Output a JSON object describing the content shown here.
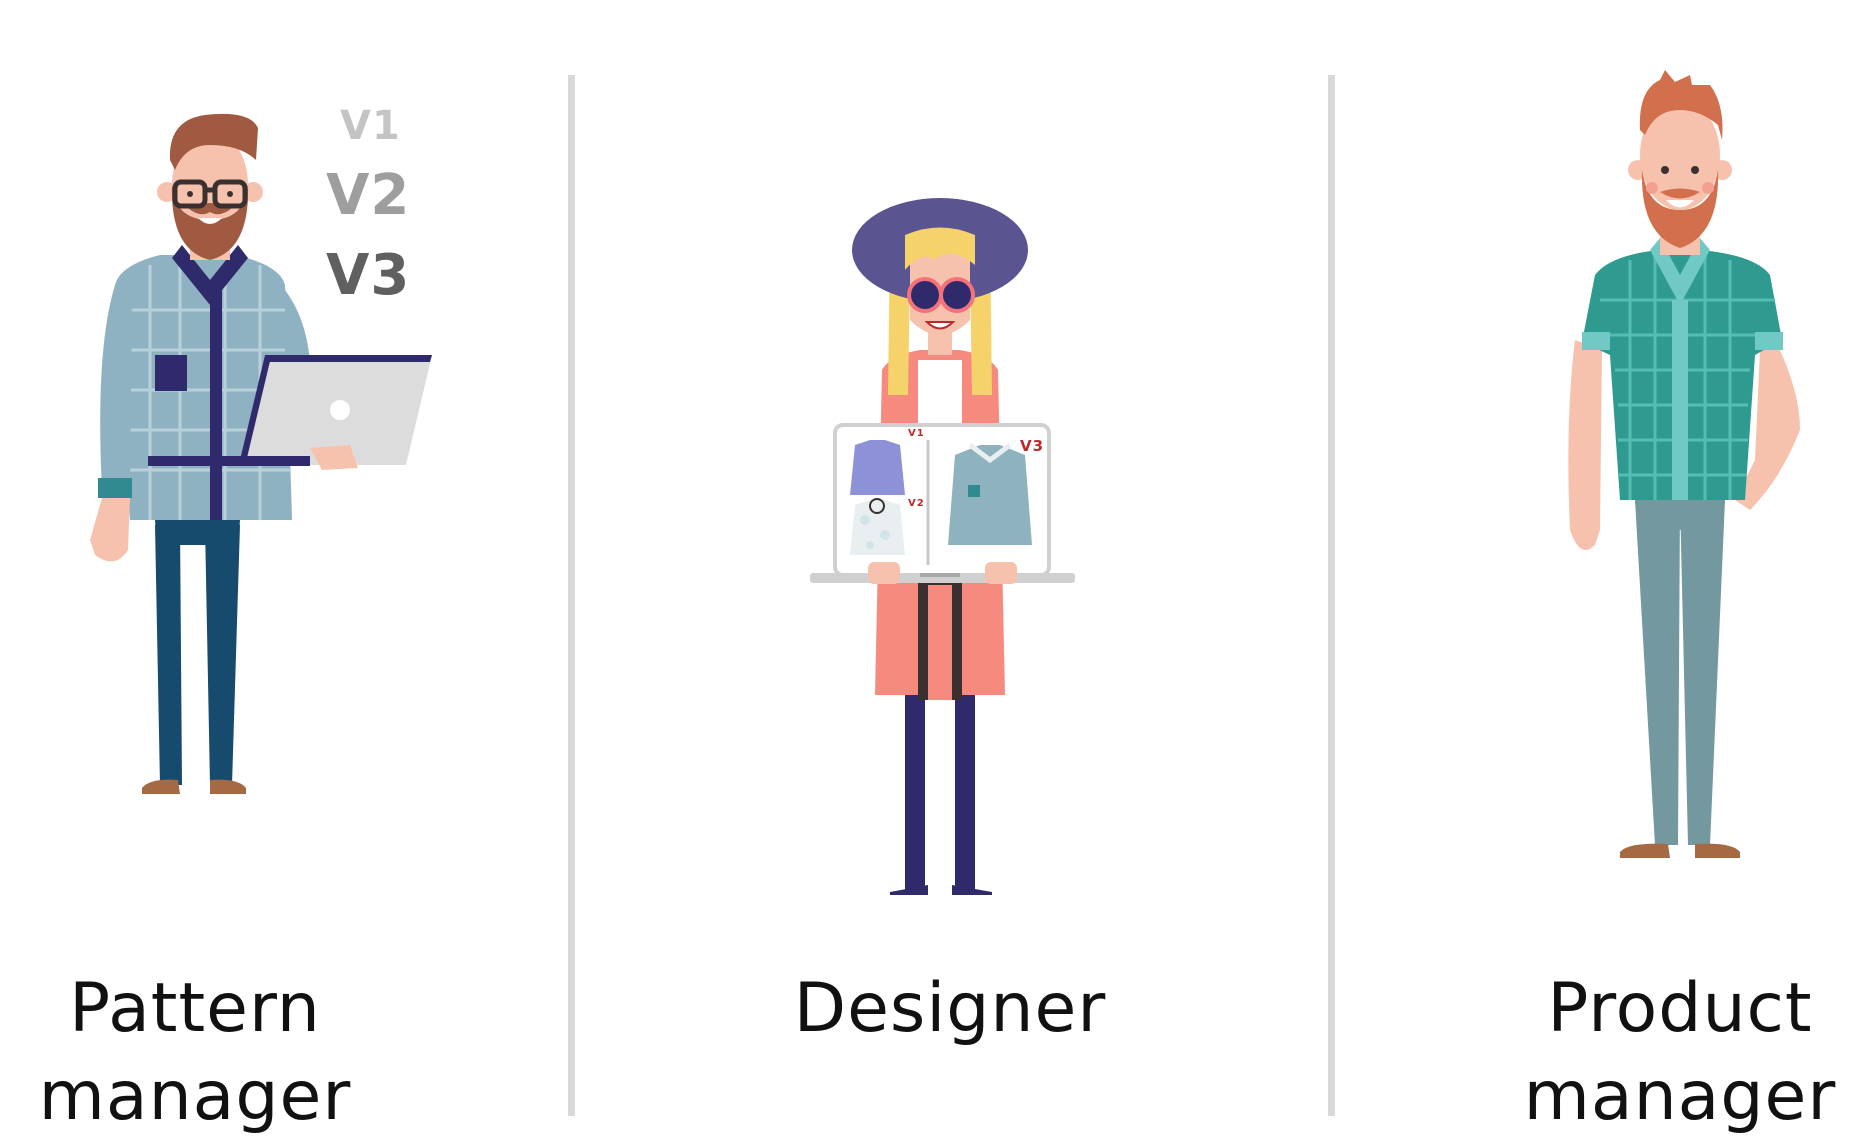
{
  "roles": [
    {
      "id": "pattern-manager",
      "line1": "Pattern",
      "line2": "manager"
    },
    {
      "id": "designer",
      "line1": "Designer"
    },
    {
      "id": "product-manager",
      "line1": "Product",
      "line2": "manager"
    }
  ],
  "versions": {
    "v1": "V1",
    "v2": "V2",
    "v3": "V3"
  },
  "screen_labels": {
    "v1": "V1",
    "v2": "V2",
    "v3": "V3"
  },
  "colors": {
    "divider": "#d9d9d9",
    "text": "#111111",
    "version_light": "#c4c4c4",
    "version_mid": "#9e9e9e",
    "version_dark": "#606060",
    "screen_label_red": "#c0272d"
  }
}
